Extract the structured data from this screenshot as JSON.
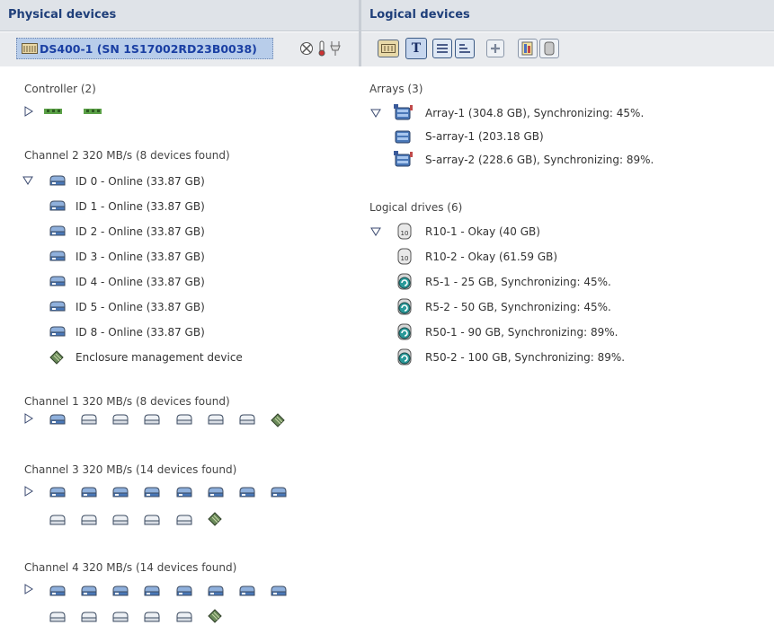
{
  "physical": {
    "header": "Physical devices",
    "device": {
      "label": "DS400-1 (SN 1S17002RD23B0038)"
    },
    "controller": {
      "title": "Controller (2)"
    },
    "channel2": {
      "title": "Channel 2  320 MB/s (8 devices found)",
      "items": [
        "ID 0 - Online (33.87 GB)",
        "ID 1 - Online (33.87 GB)",
        "ID 2 - Online (33.87 GB)",
        "ID 3 - Online (33.87 GB)",
        "ID 4 - Online (33.87 GB)",
        "ID 5 - Online (33.87 GB)",
        "ID 8 - Online (33.87 GB)",
        "Enclosure management device"
      ]
    },
    "channel1": {
      "title": "Channel 1  320 MB/s (8 devices found)"
    },
    "channel3": {
      "title": "Channel 3  320 MB/s (14 devices found)"
    },
    "channel4": {
      "title": "Channel 4  320 MB/s (14 devices found)"
    }
  },
  "logical": {
    "header": "Logical devices",
    "arrays": {
      "title": "Arrays (3)",
      "items": [
        "Array-1 (304.8 GB), Synchronizing: 45%.",
        "S-array-1 (203.18 GB)",
        "S-array-2 (228.6 GB), Synchronizing: 89%."
      ]
    },
    "drives": {
      "title": "Logical drives (6)",
      "items": [
        "R10-1 - Okay (40 GB)",
        "R10-2 - Okay (61.59 GB)",
        "R5-1 - 25 GB, Synchronizing: 45%.",
        "R5-2 - 50 GB, Synchronizing: 45%.",
        "R50-1 - 90 GB, Synchronizing: 89%.",
        "R50-2 - 100 GB, Synchronizing: 89%."
      ]
    },
    "toolbar": {
      "t_label": "T"
    }
  },
  "colors": {
    "header_text": "#1f3f7a",
    "selected_text": "#1a3fa3",
    "selected_bg": "#b8cdea"
  }
}
